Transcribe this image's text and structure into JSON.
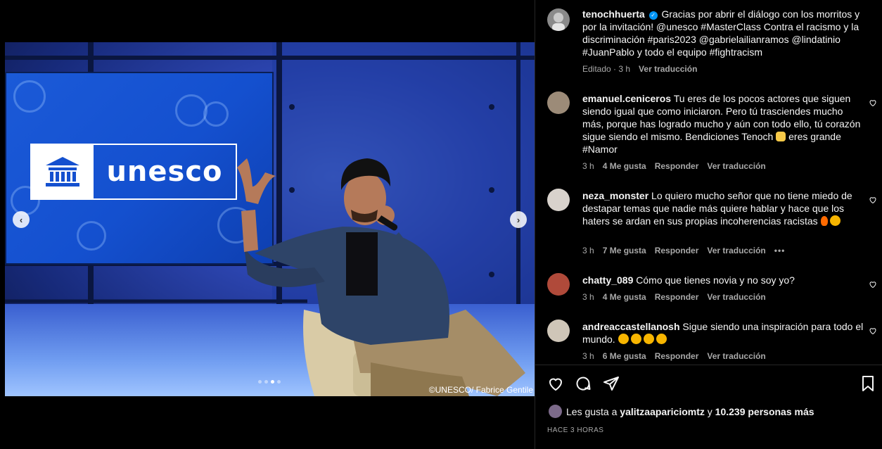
{
  "post": {
    "photo_credit": "©UNESCO/ Fabrice Gentile",
    "screen_logo_text": "unesco",
    "carousel": {
      "prev_icon": "chevron-left-icon",
      "next_icon": "chevron-right-icon",
      "slide_count": 4,
      "active_slide": 3
    }
  },
  "caption": {
    "username": "tenochhuerta",
    "text": "Gracias por abrir el diálogo con los morritos y por la invitación! @unesco #MasterClass Contra el racismo y la discriminación #paris2023 @gabrielailianramos @lindatinio #JuanPablo y todo el equipo #fightracism",
    "edited": "Editado · 3 h",
    "translate": "Ver traducción"
  },
  "comments": [
    {
      "username": "emanuel.ceniceros",
      "text": "Tu eres de los pocos actores que siguen siendo igual que como iniciaron. Pero tú trasciendes mucho más, porque has logrado mucho y aún con todo ello, tú corazón sigue siendo el mismo. Bendiciones Tenoch",
      "text_after": "eres grande #Namor",
      "time": "3 h",
      "likes": "4 Me gusta",
      "reply": "Responder",
      "translate": "Ver traducción",
      "more": ""
    },
    {
      "username": "neza_monster",
      "text": "Lo quiero mucho señor que no tiene miedo de destapar temas que nadie más quiere hablar y hace que los haters se ardan en sus propias incoherencias racistas",
      "text_after": "",
      "time": "3 h",
      "likes": "7 Me gusta",
      "reply": "Responder",
      "translate": "Ver traducción",
      "more": "•••"
    },
    {
      "username": "chatty_089",
      "text": "Cómo que tienes novia y no soy yo?",
      "text_after": "",
      "time": "3 h",
      "likes": "4 Me gusta",
      "reply": "Responder",
      "translate": "Ver traducción",
      "more": ""
    },
    {
      "username": "andreaccastellanosh",
      "text": "Sigue siendo una inspiración para todo el mundo.",
      "text_after": "",
      "time": "3 h",
      "likes": "6 Me gusta",
      "reply": "Responder",
      "translate": "Ver traducción",
      "more": ""
    }
  ],
  "actions": {
    "like_icon": "heart-icon",
    "comment_icon": "comment-icon",
    "share_icon": "send-icon",
    "save_icon": "bookmark-icon"
  },
  "likes": {
    "prefix": "Les gusta a",
    "user": "yalitzaapariciomtz",
    "middle": "y",
    "count": "10.239 personas más"
  },
  "timestamp": "HACE 3 HORAS",
  "colors": {
    "accent": "#0095f6",
    "secondary_text": "#a8a8a8",
    "divider": "#262626"
  }
}
